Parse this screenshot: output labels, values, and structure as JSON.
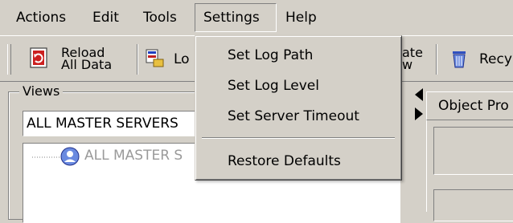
{
  "menubar": {
    "items": [
      {
        "label": "Actions"
      },
      {
        "label": "Edit"
      },
      {
        "label": "Tools"
      },
      {
        "label": "Settings"
      },
      {
        "label": "Help"
      }
    ]
  },
  "toolbar": {
    "reload_line1": "Reload",
    "reload_line2": "All Data",
    "logs_partial": "Lo",
    "update_line1": "ate",
    "update_line2": "w",
    "recycle_partial": "Recy"
  },
  "settings_menu": {
    "items": [
      {
        "label": "Set Log Path"
      },
      {
        "label": "Set Log Level"
      },
      {
        "label": "Set Server Timeout"
      },
      {
        "label": "Restore Defaults"
      }
    ]
  },
  "views": {
    "legend": "Views",
    "combo_value": "ALL MASTER SERVERS",
    "tree_node_label": "ALL MASTER S"
  },
  "right_panel": {
    "tab_label": "Object Pro"
  },
  "colors": {
    "window_bg": "#d4d0c8",
    "tree_text": "#9a9a9a"
  }
}
